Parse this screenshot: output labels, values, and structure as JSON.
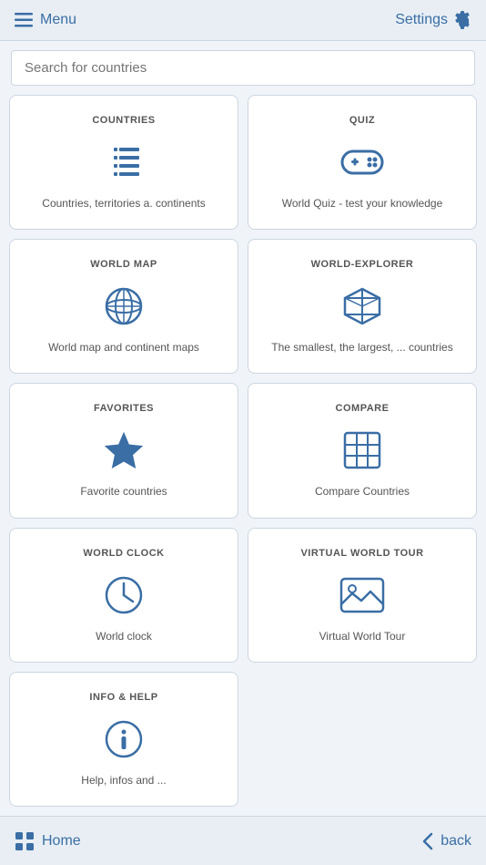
{
  "header": {
    "menu_label": "Menu",
    "settings_label": "Settings"
  },
  "search": {
    "placeholder": "Search for countries"
  },
  "cards": [
    {
      "id": "countries",
      "title": "COUNTRIES",
      "description": "Countries, territories a. continents",
      "icon": "list-icon"
    },
    {
      "id": "quiz",
      "title": "QUIZ",
      "description": "World Quiz - test your knowledge",
      "icon": "gamepad-icon"
    },
    {
      "id": "world-map",
      "title": "WORLD MAP",
      "description": "World map and continent maps",
      "icon": "globe-icon"
    },
    {
      "id": "world-explorer",
      "title": "WORLD-EXPLORER",
      "description": "The smallest, the largest, ... countries",
      "icon": "cube-icon"
    },
    {
      "id": "favorites",
      "title": "FAVORITES",
      "description": "Favorite countries",
      "icon": "star-icon"
    },
    {
      "id": "compare",
      "title": "COMPARE",
      "description": "Compare Countries",
      "icon": "grid-icon"
    },
    {
      "id": "world-clock",
      "title": "WORLD CLOCK",
      "description": "World clock",
      "icon": "clock-icon"
    },
    {
      "id": "virtual-world-tour",
      "title": "VIRTUAL WORLD TOUR",
      "description": "Virtual World Tour",
      "icon": "image-icon"
    },
    {
      "id": "info-help",
      "title": "INFO & HELP",
      "description": "Help, infos and ...",
      "icon": "info-icon"
    }
  ],
  "bottom_nav": {
    "home_label": "Home",
    "back_label": "back"
  }
}
